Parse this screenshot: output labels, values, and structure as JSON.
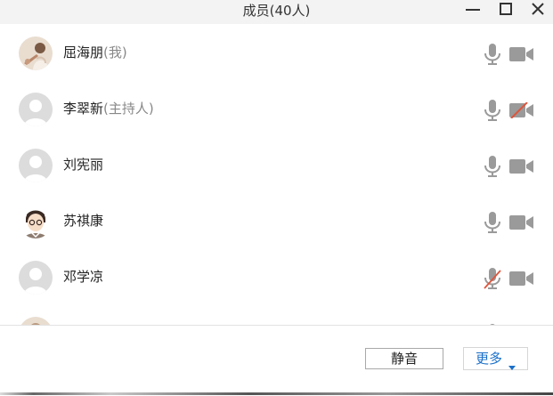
{
  "window": {
    "title": "成员(40人)",
    "controls": [
      "minimize-icon",
      "maximize-icon",
      "close-icon"
    ]
  },
  "members": [
    {
      "name": "屈海朋",
      "role": "(我)",
      "avatar": "photo",
      "mic": "on",
      "camera": "on"
    },
    {
      "name": "李翠新",
      "role": "(主持人)",
      "avatar": "default",
      "mic": "on",
      "camera": "off"
    },
    {
      "name": "刘宪丽",
      "role": "",
      "avatar": "default",
      "mic": "on",
      "camera": "on"
    },
    {
      "name": "苏祺康",
      "role": "",
      "avatar": "cartoon",
      "mic": "on",
      "camera": "on"
    },
    {
      "name": "邓学凉",
      "role": "",
      "avatar": "default",
      "mic": "muted",
      "camera": "on"
    }
  ],
  "footer": {
    "mute_label": "静音",
    "more_label": "更多"
  },
  "colors": {
    "icon_gray": "#9a9a9a",
    "muted_red": "#e0553c",
    "link_blue": "#1a6fc9"
  }
}
